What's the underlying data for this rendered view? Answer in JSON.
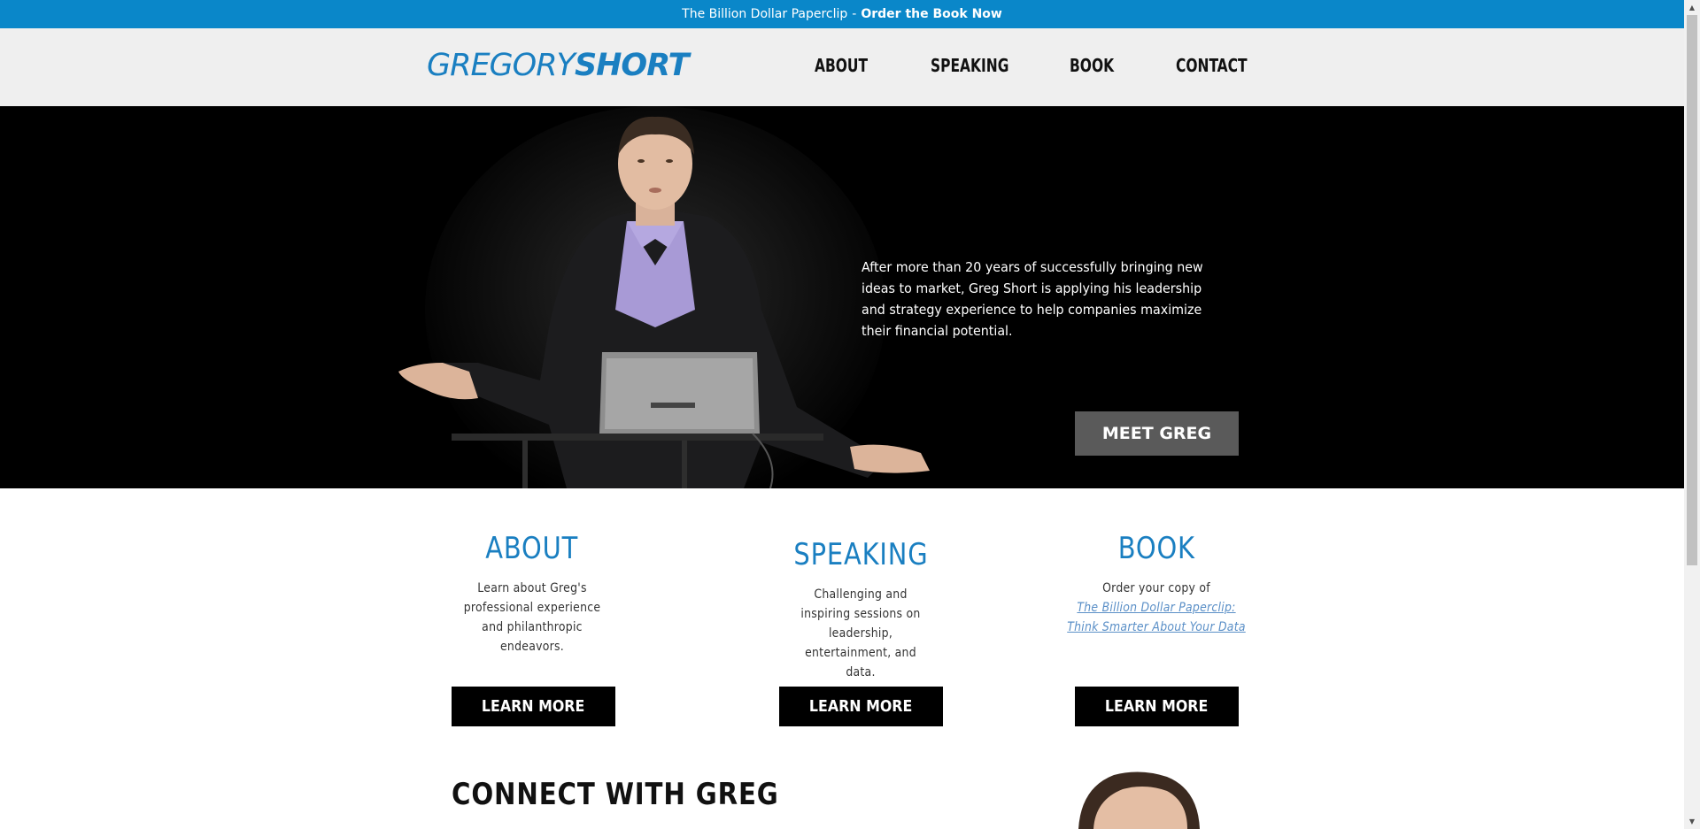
{
  "topbar": {
    "book_title": "The Billion Dollar Paperclip",
    "separator": "-",
    "cta": "Order the Book Now"
  },
  "header": {
    "logo_first": "GREGORY",
    "logo_last": "SHORT",
    "nav": [
      "ABOUT",
      "SPEAKING",
      "BOOK",
      "CONTACT"
    ]
  },
  "hero": {
    "text": "After more than 20 years of successfully bringing new ideas to market, Greg Short is applying his leadership and strategy experience to help companies maximize their financial potential.",
    "button": "MEET GREG"
  },
  "features": [
    {
      "title": "ABOUT",
      "description": "Learn about Greg's professional experience and philanthropic endeavors.",
      "button": "LEARN MORE"
    },
    {
      "title": "SPEAKING",
      "description": "Challenging and inspiring sessions on leadership, entertainment, and data.",
      "button": "LEARN MORE"
    },
    {
      "title": "BOOK",
      "description_lead": "Order your copy of",
      "description_italic_1": "The Billion Dollar Paperclip:",
      "description_italic_2": "Think Smarter About Your Data",
      "button": "LEARN MORE"
    }
  ],
  "connect": {
    "heading": "CONNECT WITH GREG"
  },
  "colors": {
    "accent": "#1a7fc1",
    "topbar": "#0a87c9",
    "header_bg": "#efefef",
    "hero_bg": "#000000",
    "meet_button": "#5a5a5a"
  },
  "icons": {
    "scroll_up": "triangle-up-icon",
    "scroll_down": "triangle-down-icon"
  }
}
